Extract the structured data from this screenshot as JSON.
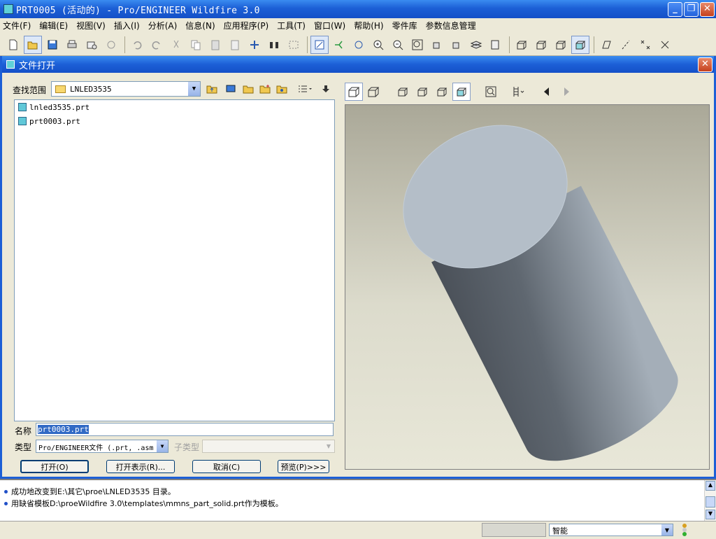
{
  "window": {
    "title": "PRT0005 (活动的) - Pro/ENGINEER Wildfire 3.0"
  },
  "menu": [
    "文件(F)",
    "编辑(E)",
    "视图(V)",
    "插入(I)",
    "分析(A)",
    "信息(N)",
    "应用程序(P)",
    "工具(T)",
    "窗口(W)",
    "帮助(H)",
    "零件库",
    "参数信息管理"
  ],
  "dialog": {
    "title": "文件打开",
    "lookin_label": "查找范围",
    "lookin_value": "LNLED3535",
    "files": [
      "lnled3535.prt",
      "prt0003.prt"
    ],
    "name_label": "名称",
    "name_value": "prt0003.prt",
    "type_label": "类型",
    "type_value": "Pro/ENGINEER文件 (.prt, .asm",
    "subtype_label": "子类型",
    "buttons": {
      "open": "打开(O)",
      "open_rep": "打开表示(R)...",
      "cancel": "取消(C)",
      "preview": "预览(P)>>>"
    }
  },
  "messages": [
    "成功地改变到E:\\其它\\proe\\LNLED3535 目录。",
    "用缺省模板D:\\proeWildfire 3.0\\templates\\mmns_part_solid.prt作为模板。"
  ],
  "status": {
    "filter": "智能"
  },
  "colors": {
    "titlebar": "#1c5fd6",
    "cylinder": "#6b7682",
    "cylinder_top": "#b4bec8",
    "viewport_bg": "#dcdbcc"
  }
}
